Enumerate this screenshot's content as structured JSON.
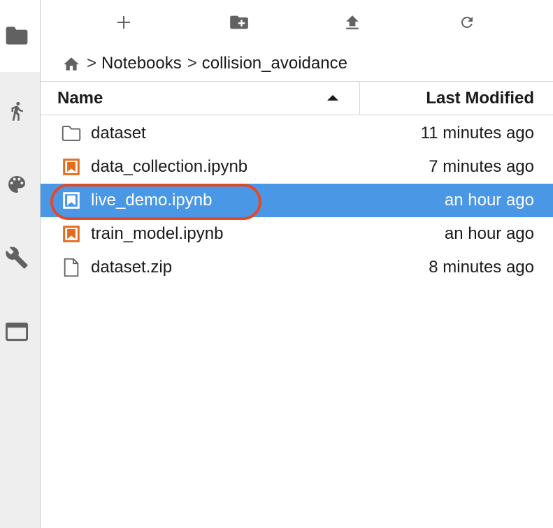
{
  "activity_bar": {
    "items": [
      {
        "icon": "folder-icon",
        "label": "File Browser"
      },
      {
        "icon": "running-icon",
        "label": "Running"
      },
      {
        "icon": "palette-icon",
        "label": "Commands"
      },
      {
        "icon": "wrench-icon",
        "label": "Settings"
      },
      {
        "icon": "tabs-icon",
        "label": "Tabs"
      }
    ]
  },
  "toolbar": {
    "buttons": [
      "new-launcher",
      "new-folder",
      "upload",
      "refresh"
    ]
  },
  "breadcrumb": {
    "items": [
      "Notebooks",
      "collision_avoidance"
    ],
    "separator": ">"
  },
  "list": {
    "headers": {
      "name": "Name",
      "modified": "Last Modified"
    },
    "rows": [
      {
        "name": "dataset",
        "modified": "11 minutes ago",
        "type": "folder",
        "selected": false
      },
      {
        "name": "data_collection.ipynb",
        "modified": "7 minutes ago",
        "type": "notebook",
        "selected": false
      },
      {
        "name": "live_demo.ipynb",
        "modified": "an hour ago",
        "type": "notebook",
        "selected": true
      },
      {
        "name": "train_model.ipynb",
        "modified": "an hour ago",
        "type": "notebook",
        "selected": false
      },
      {
        "name": "dataset.zip",
        "modified": "8 minutes ago",
        "type": "file",
        "selected": false
      }
    ]
  },
  "colors": {
    "selection": "#4a97e6",
    "notebook_icon": "#e46c1f",
    "annotation_ring": "#e04a2b"
  }
}
